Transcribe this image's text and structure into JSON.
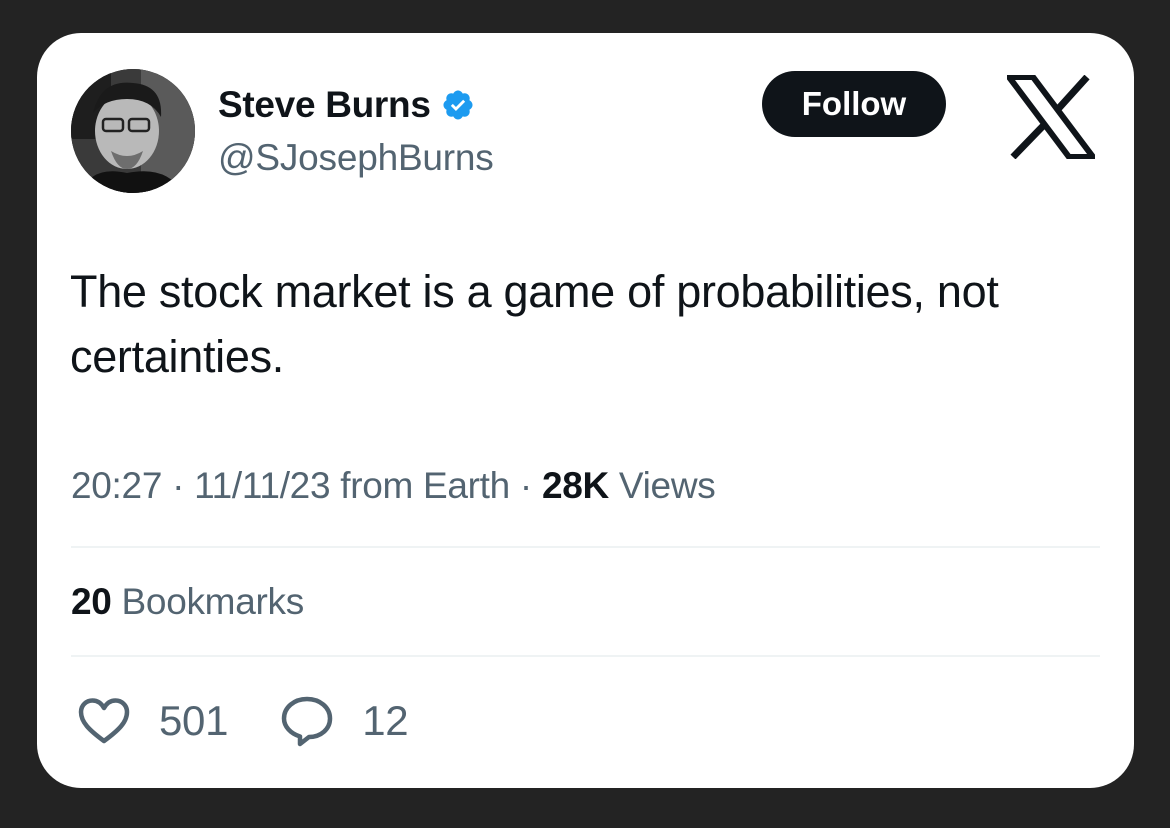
{
  "author": {
    "display_name": "Steve Burns",
    "handle": "@SJosephBurns",
    "verified": true
  },
  "follow_label": "Follow",
  "brand_icon": "x-logo-icon",
  "tweet": {
    "text": "The stock market is a game of probabilities, not certainties."
  },
  "meta": {
    "time": "20:27",
    "separator": "·",
    "date": "11/11/23",
    "location": "from Earth",
    "views_count": "28K",
    "views_label": "Views"
  },
  "bookmarks": {
    "count": "20",
    "label": "Bookmarks"
  },
  "actions": {
    "likes": {
      "icon": "heart-icon",
      "count": "501"
    },
    "replies": {
      "icon": "reply-icon",
      "count": "12"
    }
  },
  "colors": {
    "background": "#232323",
    "card": "#ffffff",
    "text_primary": "#0f1419",
    "text_secondary": "#536471",
    "verified_blue": "#1d9bf0",
    "divider": "#eff3f4"
  }
}
